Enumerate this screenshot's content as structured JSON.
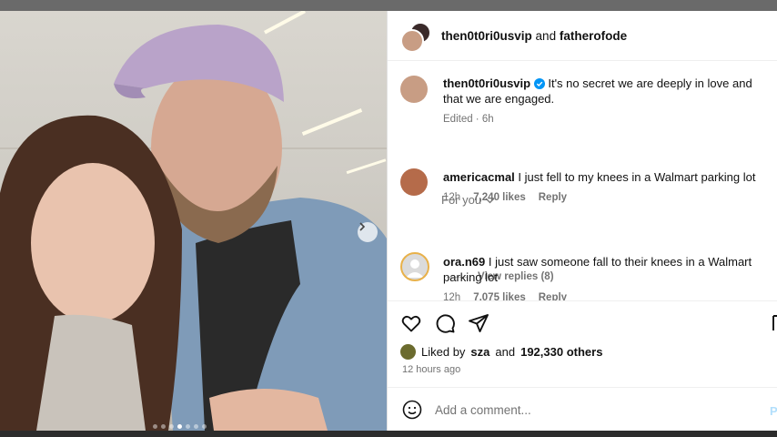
{
  "header": {
    "user1": "then0t0ri0usvip",
    "joiner": "and",
    "user2": "fatherofode"
  },
  "caption": {
    "username": "then0t0ri0usvip",
    "text": "It's no secret we are deeply in love and that we are engaged.",
    "edited": "Edited · 6h"
  },
  "for_you_label": "For you",
  "comments": [
    {
      "username": "americacmal",
      "text": "I just fell to my knees in a Walmart parking lot",
      "time": "12h",
      "likes": "7,240 likes",
      "reply": "Reply",
      "view_replies": "View replies (8)"
    },
    {
      "username": "ora.n69",
      "text": "I just saw someone fall to their knees in a Walmart parking lot",
      "time": "12h",
      "likes": "7,075 likes",
      "reply": "Reply"
    }
  ],
  "likes": {
    "prefix": "Liked by",
    "liker": "sza",
    "joiner": "and",
    "others": "192,330 others"
  },
  "post_time": "12 hours ago",
  "add_comment": {
    "placeholder": "Add a comment...",
    "post_label": "Po"
  },
  "carousel": {
    "total": 7,
    "active_index": 4
  },
  "icons": {
    "like": "heart-icon",
    "comment": "comment-icon",
    "share": "send-icon",
    "next": "chevron-right-icon",
    "emoji": "emoji-icon",
    "more": "more-options-icon"
  },
  "colors": {
    "verified": "#0095f6",
    "post_button": "#b2dffc"
  }
}
